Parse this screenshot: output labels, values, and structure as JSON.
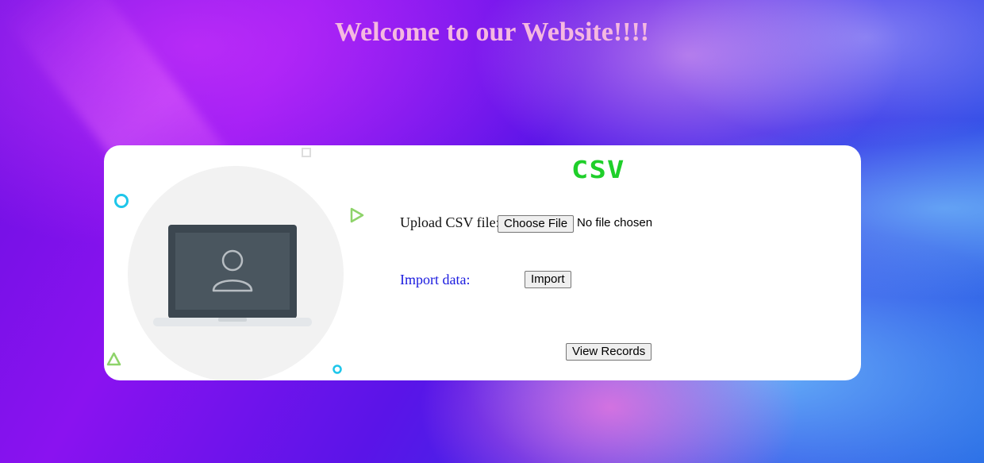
{
  "page": {
    "title": "Welcome to our Website!!!!"
  },
  "card": {
    "logo_text": "CSV",
    "upload_label": "Upload CSV file:",
    "file_button_label": "Choose File",
    "file_status": "No file chosen",
    "import_label": "Import data:",
    "import_button_label": "Import",
    "view_records_label": "View Records"
  },
  "colors": {
    "title": "#f5b8e0",
    "logo": "#1fcf2a",
    "import_label": "#1a1adf",
    "card_bg": "#ffffff"
  },
  "icons": {
    "illustration": "laptop-user-icon"
  }
}
